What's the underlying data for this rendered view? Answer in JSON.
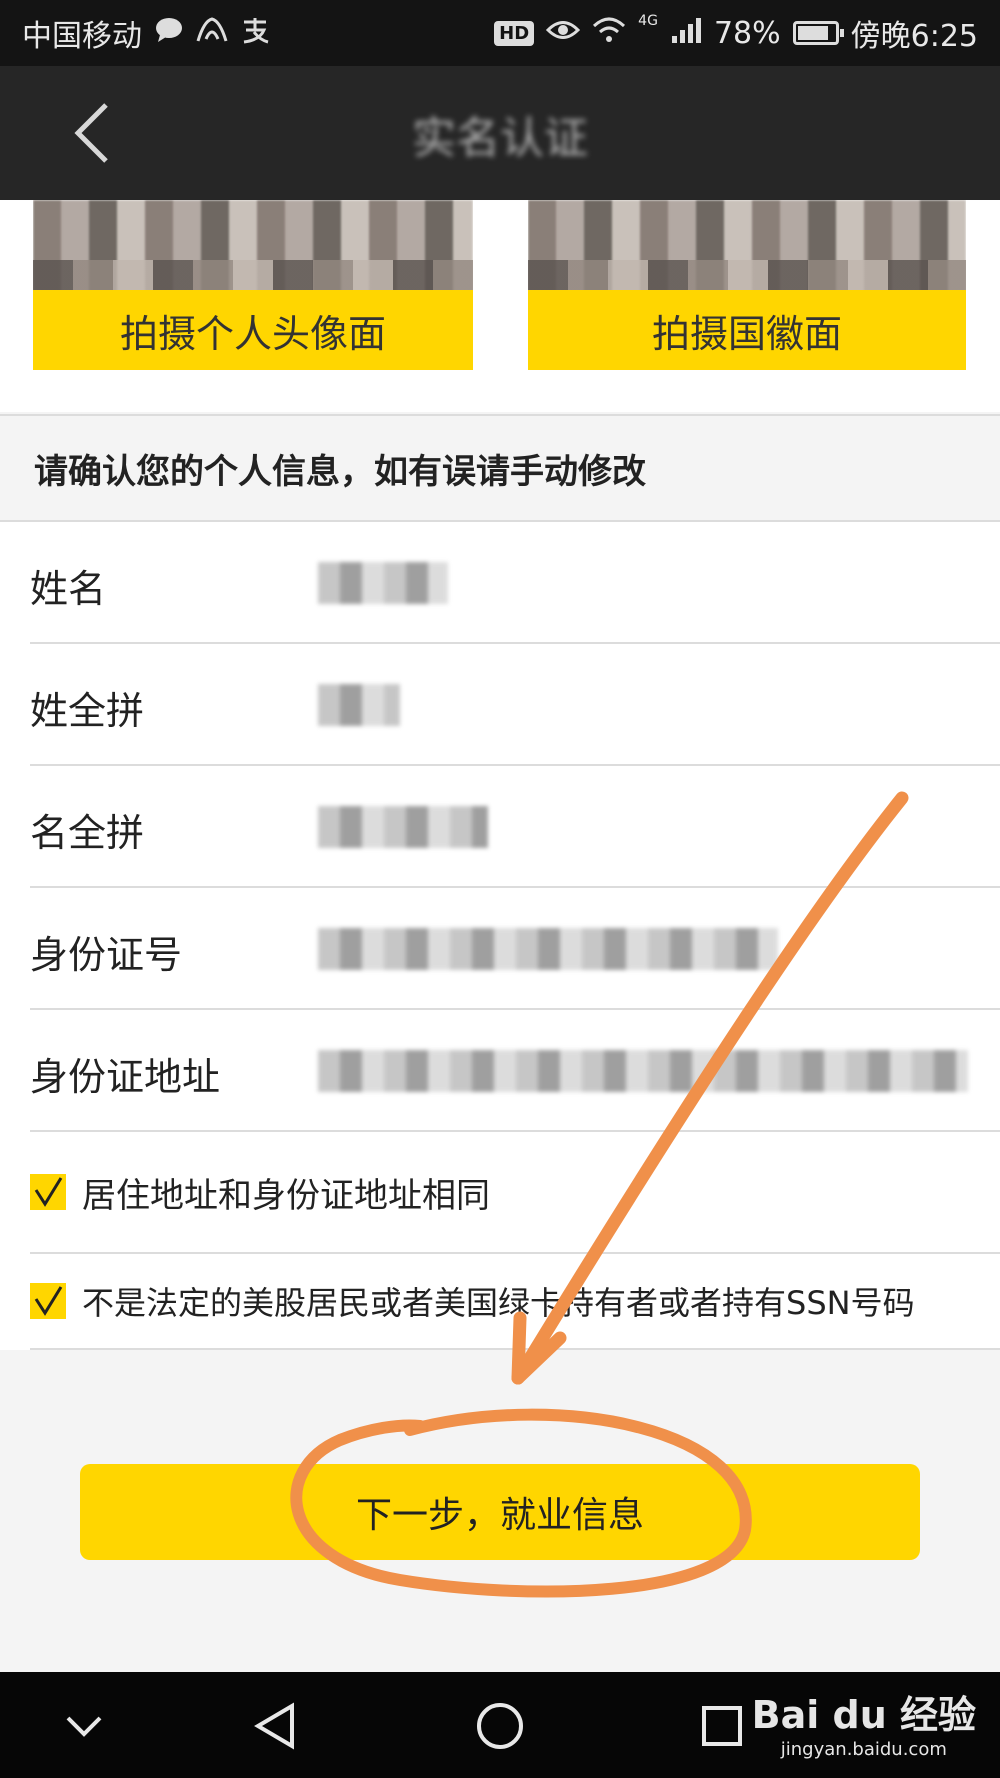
{
  "status_bar": {
    "carrier": "中国移动",
    "network": "4G",
    "battery": "78%",
    "battery_level": 0.78,
    "time": "傍晚6:25",
    "hd": "HD"
  },
  "header": {
    "title": "实名认证"
  },
  "photos": {
    "front_label": "拍摄个人头像面",
    "back_label": "拍摄国徽面"
  },
  "section": {
    "title": "请确认您的个人信息，如有误请手动修改"
  },
  "form": {
    "fields": [
      {
        "label": "姓名",
        "value": ""
      },
      {
        "label": "姓全拼",
        "value": ""
      },
      {
        "label": "名全拼",
        "value": ""
      },
      {
        "label": "身份证号",
        "value": ""
      },
      {
        "label": "身份证地址",
        "value": ""
      }
    ]
  },
  "checks": [
    {
      "label": "居住地址和身份证地址相同",
      "checked": true
    },
    {
      "label": "不是法定的美股居民或者美国绿卡持有者或者持有SSN号码",
      "checked": true
    }
  ],
  "next_button": {
    "label": "下一步，就业信息"
  },
  "watermark": {
    "logo": "Bai du 经验",
    "site": "jingyan.baidu.com"
  },
  "colors": {
    "accent": "#ffd600",
    "annotation": "#f0904a",
    "title_bar": "#262626"
  }
}
